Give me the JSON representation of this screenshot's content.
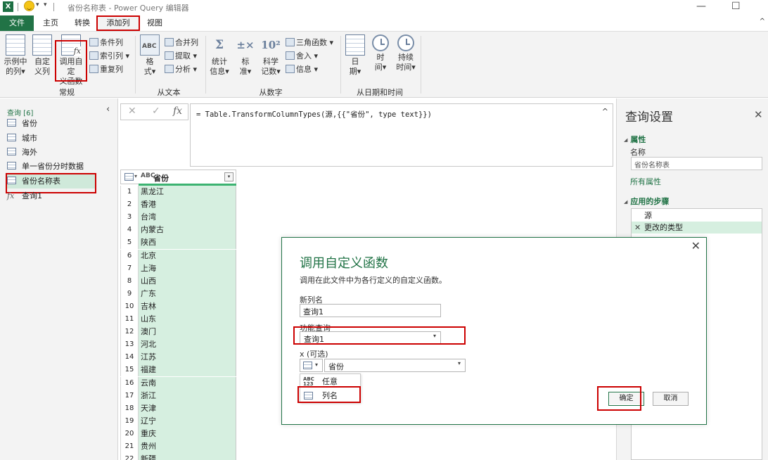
{
  "titlebar": {
    "app_icon": "X",
    "title": "省份名称表 - Power Query 编辑器",
    "minimize": "—",
    "maximize": "☐",
    "close": "✕"
  },
  "menu": {
    "tabs": [
      "文件",
      "主页",
      "转换",
      "添加列",
      "视图"
    ],
    "active_tab": "添加列",
    "collapse_icon": "^"
  },
  "ribbon": {
    "general": {
      "label": "常规",
      "example_col": [
        "示例中",
        "的列▾"
      ],
      "custom_col": [
        "自定",
        "义列"
      ],
      "invoke_func": [
        "调用自定",
        "义函数"
      ],
      "cond_col": "条件列",
      "index_col": "索引列 ▾",
      "dup_col": "重复列"
    },
    "text": {
      "label": "从文本",
      "format": [
        "格",
        "式▾"
      ],
      "merge": "合并列",
      "extract": "提取 ▾",
      "parse": "分析 ▾"
    },
    "number": {
      "label": "从数字",
      "stats": [
        "统计",
        "信息▾"
      ],
      "standard": [
        "标",
        "准▾"
      ],
      "scientific": [
        "科学",
        "记数▾"
      ],
      "trig": "三角函数 ▾",
      "round": "舍入 ▾",
      "info": "信息 ▾"
    },
    "datetime": {
      "label": "从日期和时间",
      "date": [
        "日",
        "期▾"
      ],
      "time": [
        "时",
        "间▾"
      ],
      "duration": [
        "持续",
        "时间▾"
      ]
    }
  },
  "queries": {
    "header": "查询 [6]",
    "collapse": "‹",
    "items": [
      {
        "label": "省份",
        "type": "table"
      },
      {
        "label": "城市",
        "type": "table"
      },
      {
        "label": "海外",
        "type": "table"
      },
      {
        "label": "单一省份分时数据",
        "type": "table"
      },
      {
        "label": "省份名称表",
        "type": "table",
        "selected": true
      },
      {
        "label": "查询1",
        "type": "function"
      }
    ]
  },
  "formula": {
    "cancel": "✕",
    "confirm": "✓",
    "fx": "fx",
    "text": "= Table.TransformColumnTypes(源,{{\"省份\", type text}})",
    "expand": "^"
  },
  "grid": {
    "type_badge": "ABC",
    "column": "省份",
    "filter_icon": "▾",
    "rows": [
      "黑龙江",
      "香港",
      "台湾",
      "内蒙古",
      "陕西",
      "北京",
      "上海",
      "山西",
      "广东",
      "吉林",
      "山东",
      "澳门",
      "河北",
      "江苏",
      "福建",
      "云南",
      "浙江",
      "天津",
      "辽宁",
      "重庆",
      "贵州",
      "新疆"
    ]
  },
  "settings": {
    "title": "查询设置",
    "close": "✕",
    "properties": "属性",
    "name_label": "名称",
    "name_value": "省份名称表",
    "all_props": "所有属性",
    "steps_header": "应用的步骤",
    "steps": [
      {
        "label": "源",
        "selected": false
      },
      {
        "label": "更改的类型",
        "selected": true
      }
    ],
    "step_delete": "✕"
  },
  "dialog": {
    "close": "✕",
    "title": "调用自定义函数",
    "description": "调用在此文件中为各行定义的自定义函数。",
    "new_col_label": "新列名",
    "new_col_value": "查询1",
    "func_query_label": "功能查询",
    "func_query_value": "查询1",
    "param_label": "x (可选)",
    "param_value": "省份",
    "dropdown_arrow": "▾",
    "menu": [
      {
        "label": "任意",
        "icon": "ABC 123"
      },
      {
        "label": "列名",
        "icon": "table"
      }
    ],
    "ok": "确定",
    "cancel": "取消"
  },
  "colors": {
    "brand_green": "#217346",
    "selection_green": "#cfe9da",
    "highlight_red": "#cc0000"
  }
}
